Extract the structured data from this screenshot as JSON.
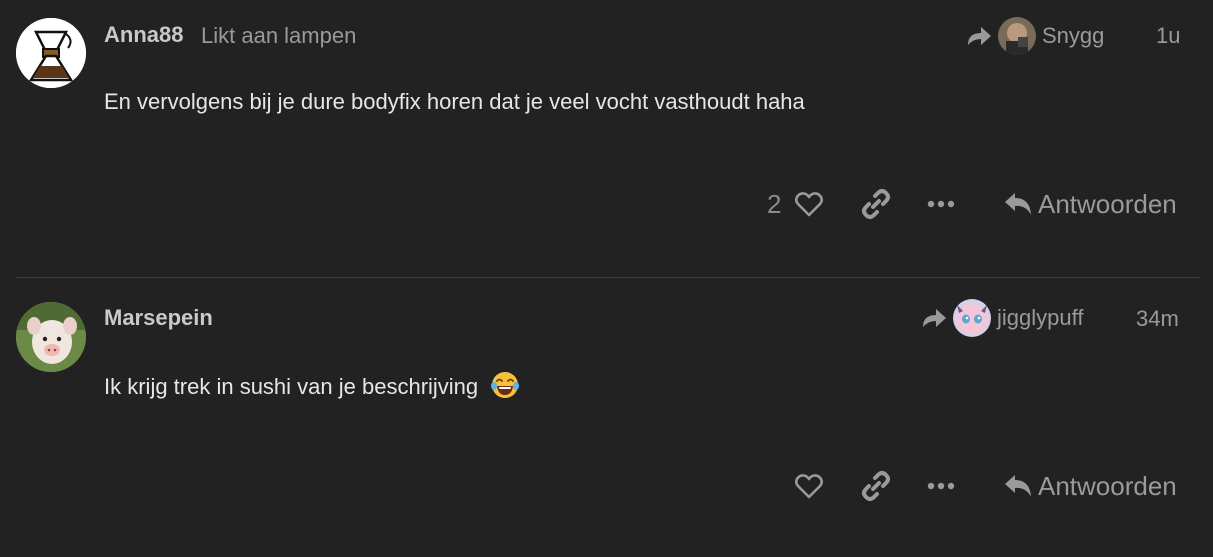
{
  "posts": [
    {
      "username": "Anna88",
      "user_title": "Likt aan lampen",
      "reply_to_name": "Snygg",
      "date": "1u",
      "body": "En vervolgens bij je dure bodyfix horen dat je veel vocht vasthoudt haha",
      "like_count": "2",
      "reply_label": "Antwoorden",
      "avatar_icon": "coffee-maker-icon"
    },
    {
      "username": "Marsepein",
      "reply_to_name": "jigglypuff",
      "date": "34m",
      "body": "Ik krijg trek in sushi van je beschrijving",
      "reply_label": "Antwoorden",
      "avatar_icon": "piglet-photo",
      "emoji": "joy-emoji"
    }
  ],
  "colors": {
    "background": "#222222",
    "text": "#e6e6e6",
    "muted": "#9a9a9a",
    "divider": "#3a3a3a"
  }
}
